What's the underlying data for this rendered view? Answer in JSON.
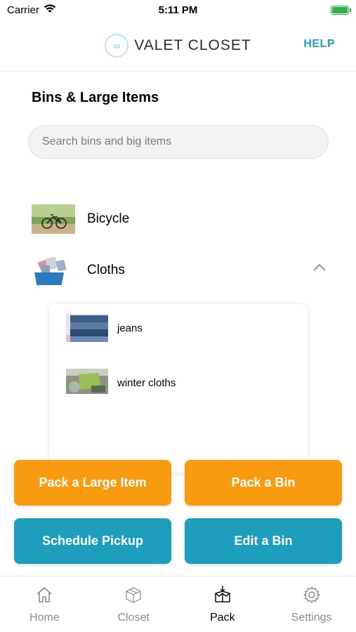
{
  "status_bar": {
    "carrier": "Carrier",
    "time": "5:11 PM"
  },
  "header": {
    "brand": "VALET CLOSET",
    "help_label": "HELP"
  },
  "page": {
    "title": "Bins & Large Items",
    "search_placeholder": "Search bins and big items"
  },
  "items": [
    {
      "label": "Bicycle",
      "thumbnail": "bicycle-photo"
    },
    {
      "label": "Cloths",
      "thumbnail": "cloths-bin-photo",
      "expanded": true
    }
  ],
  "cloths_sub_items": [
    {
      "label": "jeans",
      "thumbnail": "jeans-photo"
    },
    {
      "label": "winter cloths",
      "thumbnail": "winter-cloths-photo"
    }
  ],
  "actions": {
    "pack_large_item": "Pack a Large Item",
    "pack_bin": "Pack a Bin",
    "schedule_pickup": "Schedule Pickup",
    "edit_bin": "Edit a Bin"
  },
  "tabs": [
    {
      "label": "Home",
      "icon": "home-icon"
    },
    {
      "label": "Closet",
      "icon": "box-icon"
    },
    {
      "label": "Pack",
      "icon": "pack-box-icon",
      "active": true
    },
    {
      "label": "Settings",
      "icon": "gear-icon"
    }
  ],
  "colors": {
    "accent_orange": "#f99b10",
    "accent_teal": "#1d9ebd",
    "help_link": "#1fa0bd",
    "battery": "#2db34a"
  }
}
